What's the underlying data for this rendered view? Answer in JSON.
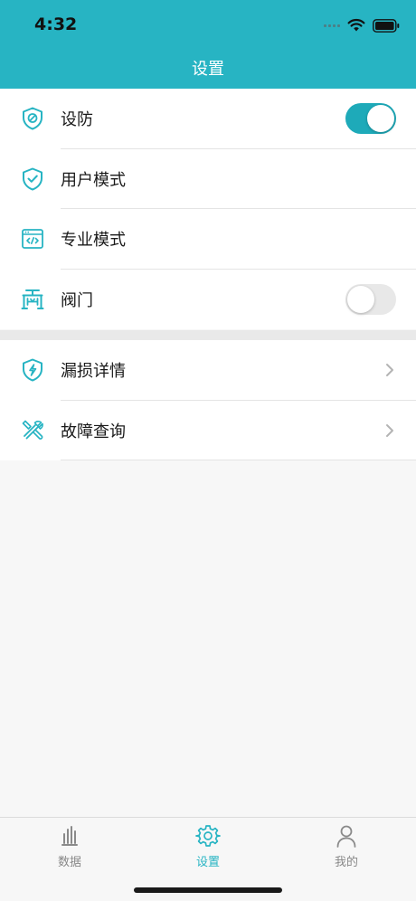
{
  "status_bar": {
    "time": "4:32"
  },
  "nav": {
    "title": "设置"
  },
  "colors": {
    "accent": "#27b4c3",
    "toggle_on": "#1eaab9"
  },
  "settings_group_1": [
    {
      "label": "设防",
      "icon": "shield-block-icon",
      "control": "toggle",
      "on": true
    },
    {
      "label": "用户模式",
      "icon": "shield-check-icon",
      "control": "none"
    },
    {
      "label": "专业模式",
      "icon": "code-window-icon",
      "control": "none"
    },
    {
      "label": "阀门",
      "icon": "valve-icon",
      "control": "toggle",
      "on": false
    }
  ],
  "settings_group_2": [
    {
      "label": "漏损详情",
      "icon": "shield-bolt-icon",
      "control": "chevron"
    },
    {
      "label": "故障查询",
      "icon": "tools-icon",
      "control": "chevron"
    }
  ],
  "tabbar": {
    "tabs": [
      {
        "label": "数据",
        "icon": "bar-chart-icon",
        "active": false
      },
      {
        "label": "设置",
        "icon": "gear-icon",
        "active": true
      },
      {
        "label": "我的",
        "icon": "user-icon",
        "active": false
      }
    ]
  }
}
